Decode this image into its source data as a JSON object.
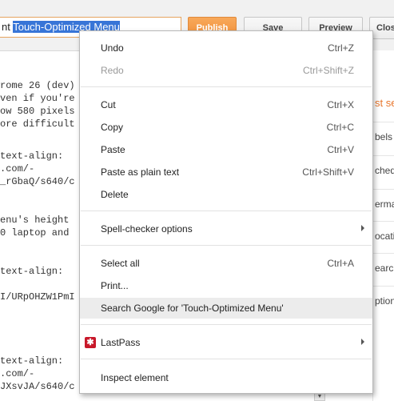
{
  "toolbar": {
    "title_prefix": "nt ",
    "title_selected": "Touch-Optimized Menu",
    "publish": "Publish",
    "save": "Save",
    "preview": "Preview",
    "close": "Clos"
  },
  "editor_lines": [
    "rome 26 (dev)",
    "ven if you're",
    "ow 580 pixels",
    "ore difficult",
    "",
    "  text-align:",
    ".com/-",
    "_rGbaQ/s640/c",
    "",
    "enu's height",
    "0 laptop and",
    "",
    "",
    "  text-align:",
    "",
    "I/URpOHZW1PmI",
    "",
    "",
    "",
    "",
    "",
    "  text-align:",
    ".com/-",
    "JXsvJA/s640/c"
  ],
  "right_panel": [
    "st se",
    "bels",
    "ched",
    "erma",
    "ocati",
    "earch",
    "ption"
  ],
  "menu": {
    "undo": {
      "label": "Undo",
      "shortcut": "Ctrl+Z"
    },
    "redo": {
      "label": "Redo",
      "shortcut": "Ctrl+Shift+Z"
    },
    "cut": {
      "label": "Cut",
      "shortcut": "Ctrl+X"
    },
    "copy": {
      "label": "Copy",
      "shortcut": "Ctrl+C"
    },
    "paste": {
      "label": "Paste",
      "shortcut": "Ctrl+V"
    },
    "paste_plain": {
      "label": "Paste as plain text",
      "shortcut": "Ctrl+Shift+V"
    },
    "delete": {
      "label": "Delete"
    },
    "spell": {
      "label": "Spell-checker options"
    },
    "select_all": {
      "label": "Select all",
      "shortcut": "Ctrl+A"
    },
    "print": {
      "label": "Print..."
    },
    "search_google": {
      "label": "Search Google for 'Touch-Optimized Menu'"
    },
    "lastpass": {
      "label": "LastPass",
      "icon": "lastpass-icon",
      "icon_glyph": "✱"
    },
    "inspect": {
      "label": "Inspect element"
    }
  },
  "colors": {
    "accent_orange": "#f08f39",
    "selection_blue": "#3875d7",
    "lastpass_red": "#c8182a"
  }
}
